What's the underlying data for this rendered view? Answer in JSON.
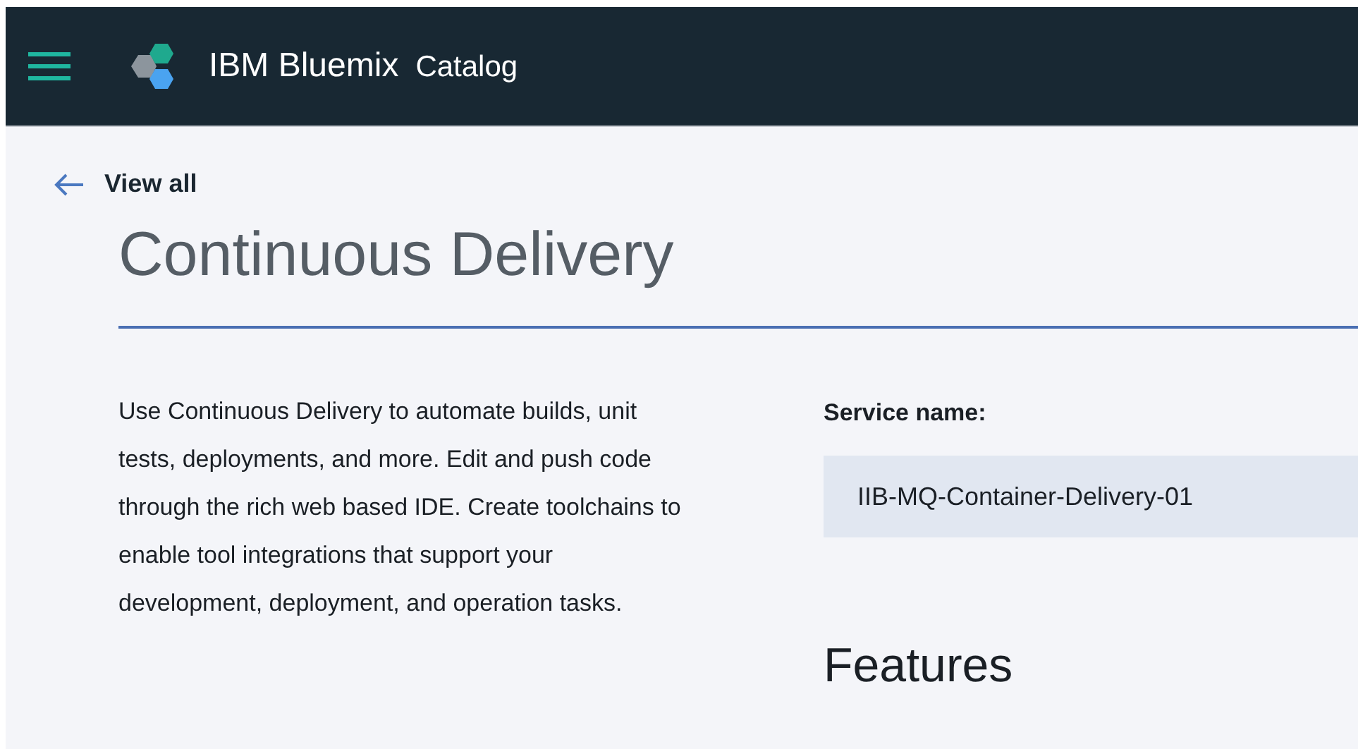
{
  "header": {
    "brand": "IBM Bluemix",
    "section": "Catalog"
  },
  "back_link": {
    "label": "View all"
  },
  "title": "Continuous Delivery",
  "description": "Use Continuous Delivery to automate builds, unit tests, deployments, and more. Edit and push code through the rich web based IDE. Create toolchains to enable tool integrations that support your development, deployment, and operation tasks.",
  "service_name": {
    "label": "Service name:",
    "value": "IIB-MQ-Container-Delivery-01"
  },
  "features_heading": "Features"
}
